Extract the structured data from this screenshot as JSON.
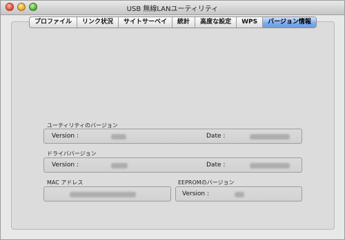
{
  "window": {
    "title": "USB 無線LANユーティリティ"
  },
  "tabs": [
    {
      "label": "プロファイル",
      "active": false
    },
    {
      "label": "リンク状況",
      "active": false
    },
    {
      "label": "サイトサーベイ",
      "active": false
    },
    {
      "label": "統計",
      "active": false
    },
    {
      "label": "高度な設定",
      "active": false
    },
    {
      "label": "WPS",
      "active": false
    },
    {
      "label": "バージョン情報",
      "active": true
    }
  ],
  "utility_version": {
    "group_label": "ユーティリティのバージョン",
    "version_label": "Version :",
    "date_label": "Date :"
  },
  "driver_version": {
    "group_label": "ドライババージョン",
    "version_label": "Version :",
    "date_label": "Date :"
  },
  "mac_address": {
    "group_label": "MAC アドレス"
  },
  "eeprom_version": {
    "group_label": "EEPROMのバージョン",
    "version_label": "Version :"
  },
  "colors": {
    "active_tab": "#7aa9ec",
    "panel": "#dcdcdc"
  }
}
